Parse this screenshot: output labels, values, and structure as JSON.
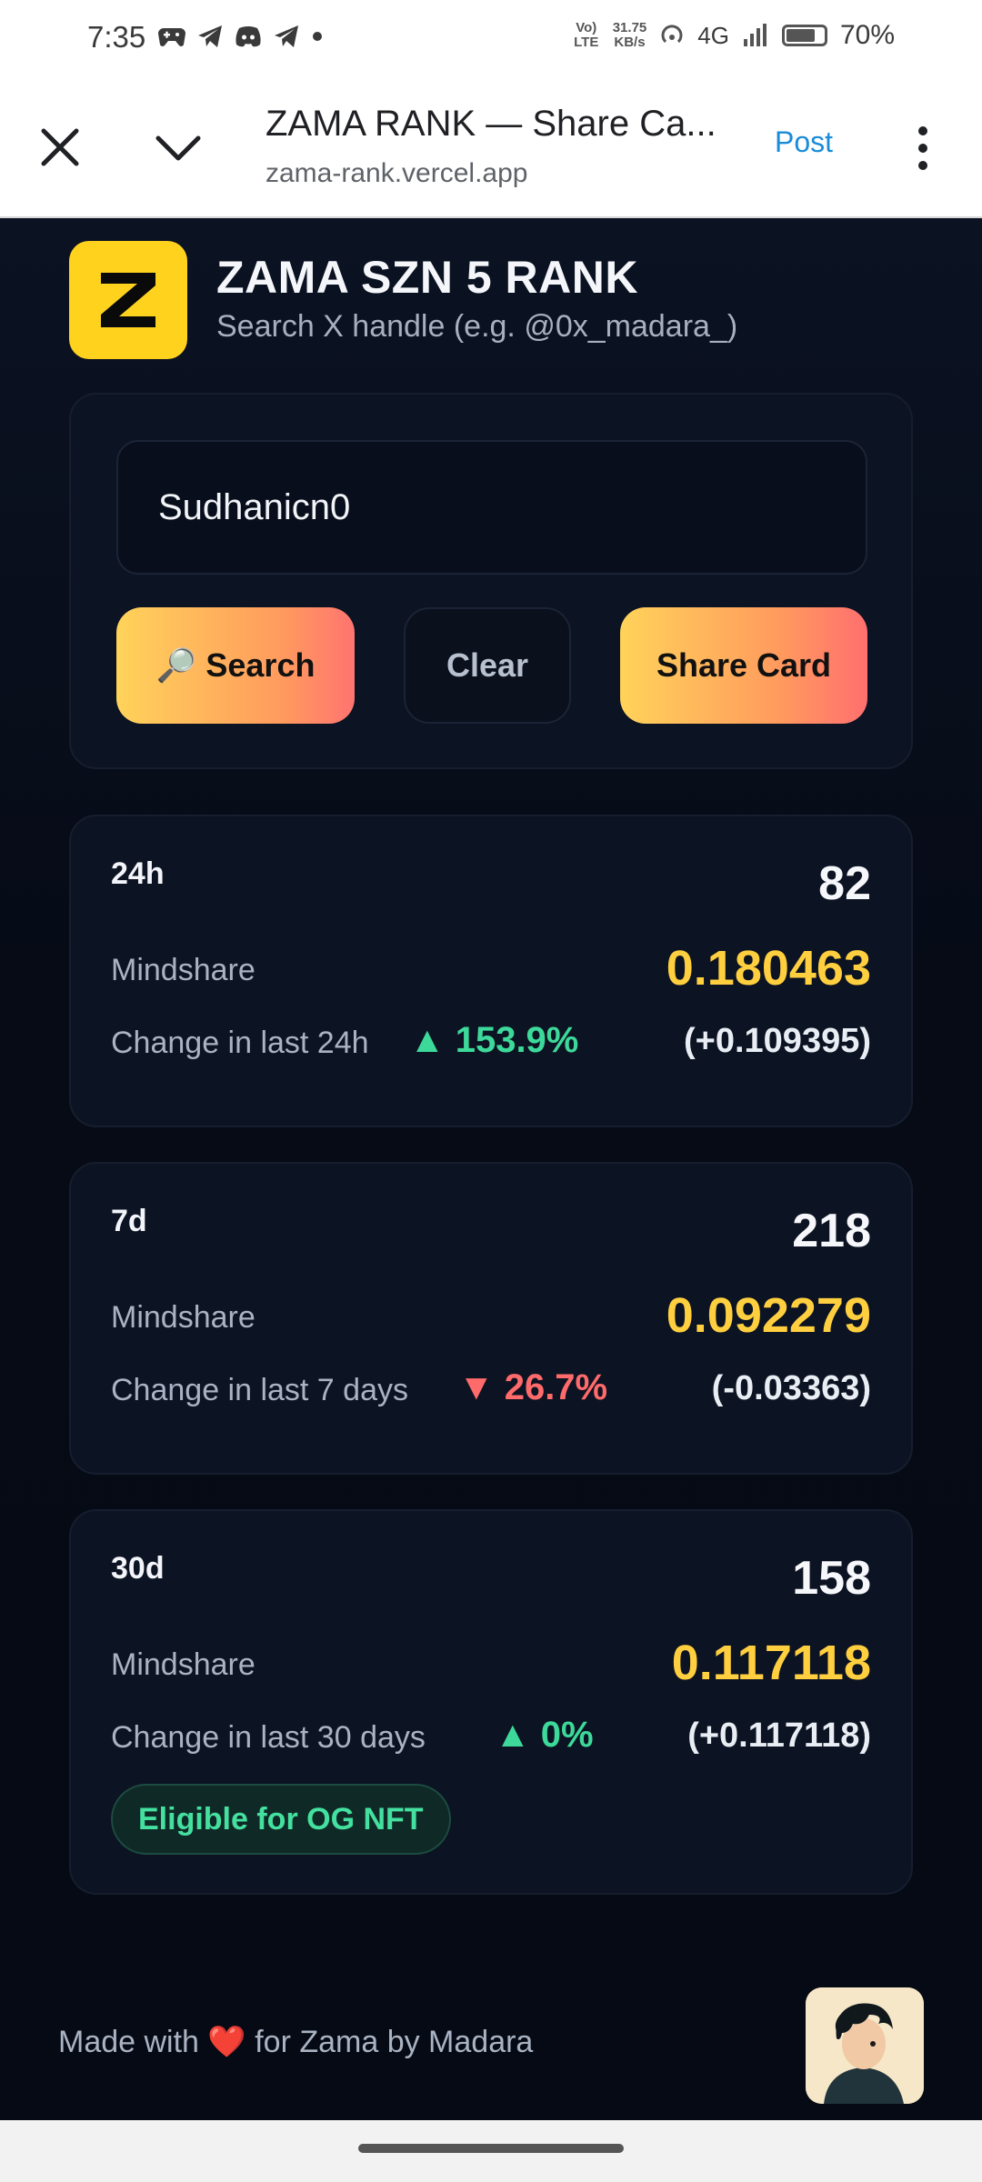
{
  "status_bar": {
    "time": "7:35",
    "notification_icons": [
      "game-controller-icon",
      "telegram-icon",
      "discord-icon",
      "telegram-icon",
      "dot-icon"
    ],
    "volte": "Vo) LTE",
    "net_speed": "31.75",
    "net_unit": "KB/s",
    "network": "4G",
    "battery": "70%"
  },
  "browser": {
    "title": "ZAMA RANK — Share Ca...",
    "url": "zama-rank.vercel.app",
    "post_label": "Post"
  },
  "app": {
    "logo_letter": "Z",
    "title": "ZAMA SZN 5 RANK",
    "subtitle": "Search X handle (e.g. @0x_madara_)"
  },
  "search": {
    "value": "Sudhanicn0",
    "search_label": "🔎 Search",
    "clear_label": "Clear",
    "share_label": "Share Card"
  },
  "stats": [
    {
      "period": "24h",
      "rank": "82",
      "mindshare_label": "Mindshare",
      "mindshare": "0.180463",
      "change_label": "Change in last 24h",
      "change_dir": "up",
      "change_pct": "▲ 153.9%",
      "change_abs": "(+0.109395)"
    },
    {
      "period": "7d",
      "rank": "218",
      "mindshare_label": "Mindshare",
      "mindshare": "0.092279",
      "change_label": "Change in last 7 days",
      "change_dir": "down",
      "change_pct": "▼ 26.7%",
      "change_abs": "(-0.03363)"
    },
    {
      "period": "30d",
      "rank": "158",
      "mindshare_label": "Mindshare",
      "mindshare": "0.117118",
      "change_label": "Change in last 30 days",
      "change_dir": "up",
      "change_pct": "▲ 0%",
      "change_abs": "(+0.117118)",
      "badge": "Eligible for OG NFT"
    }
  ],
  "footer": {
    "prefix": "Made with",
    "heart": "❤️",
    "suffix": "for Zama by Madara"
  },
  "colors": {
    "accent_yellow": "#ffcf3f",
    "up": "#3dd99a",
    "down": "#ff6b6b",
    "logo_bg": "#ffd21e"
  }
}
